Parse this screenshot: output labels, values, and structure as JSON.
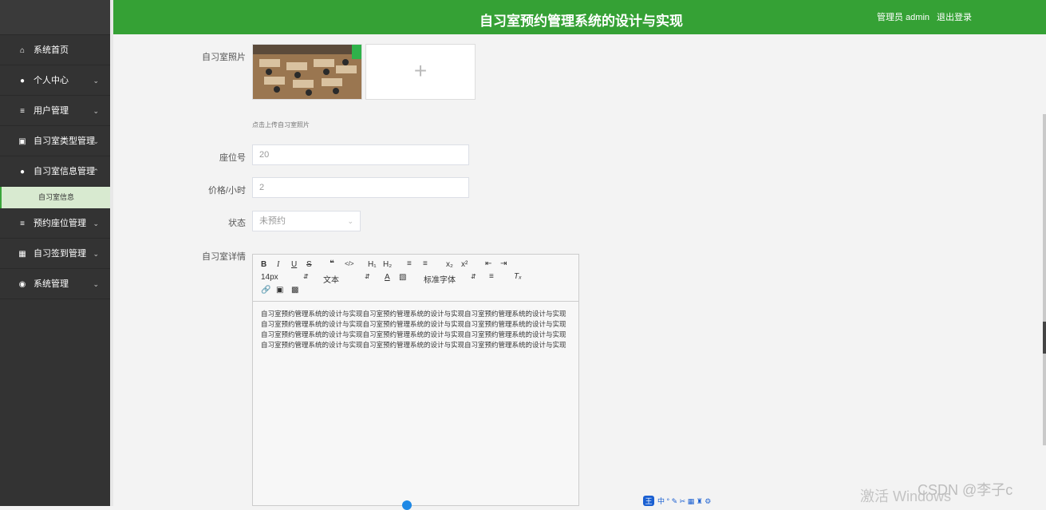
{
  "header": {
    "title": "自习室预约管理系统的设计与实现",
    "user": "管理员 admin",
    "logout": "退出登录"
  },
  "sidebar": {
    "items": [
      {
        "label": "系统首页",
        "icon": "home-icon",
        "has_arrow": false
      },
      {
        "label": "个人中心",
        "icon": "user-icon",
        "has_arrow": true
      },
      {
        "label": "用户管理",
        "icon": "list-icon",
        "has_arrow": true
      },
      {
        "label": "自习室类型管理",
        "icon": "clipboard-icon",
        "has_arrow": true
      },
      {
        "label": "自习室信息管理",
        "icon": "user-icon",
        "has_arrow": true
      },
      {
        "label": "预约座位管理",
        "icon": "list-icon",
        "has_arrow": true
      },
      {
        "label": "自习签到管理",
        "icon": "grid-icon",
        "has_arrow": true
      },
      {
        "label": "系统管理",
        "icon": "bulb-icon",
        "has_arrow": true
      }
    ],
    "submenu_active": "自习室信息"
  },
  "form": {
    "photo_label": "自习室照片",
    "photo_hint": "点击上传自习室照片",
    "seat_label": "座位号",
    "seat_value": "20",
    "price_label": "价格/小时",
    "price_value": "2",
    "status_label": "状态",
    "status_value": "未预约",
    "detail_label": "自习室详情"
  },
  "editor": {
    "font_size": "14px",
    "block_type": "文本",
    "font_family": "标准字体",
    "content": "自习室预约管理系统的设计与实现自习室预约管理系统的设计与实现自习室预约管理系统的设计与实现自习室预约管理系统的设计与实现自习室预约管理系统的设计与实现自习室预约管理系统的设计与实现自习室预约管理系统的设计与实现自习室预约管理系统的设计与实现自习室预约管理系统的设计与实现自习室预约管理系统的设计与实现自习室预约管理系统的设计与实现自习室预约管理系统的设计与实现"
  },
  "watermarks": {
    "windows": "激活 Windows",
    "csdn": "CSDN @李子c"
  },
  "ime": {
    "logo": "王",
    "label": "中"
  },
  "colors": {
    "header_bg": "#35a135",
    "sidebar_bg": "#333333",
    "submenu_bg": "#d8ead0"
  }
}
